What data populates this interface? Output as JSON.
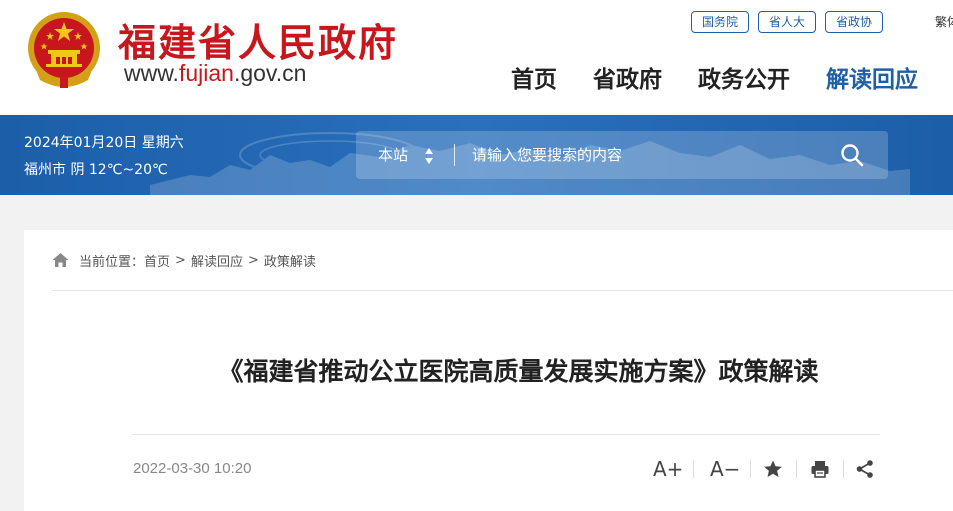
{
  "header": {
    "site_title": "福建省人民政府",
    "url_prefix": "www.",
    "url_highlight": "fujian",
    "url_suffix": ".gov.cn",
    "top_links": [
      "国务院",
      "省人大",
      "省政协"
    ],
    "lang_toggle": "繁体",
    "nav": [
      "首页",
      "省政府",
      "政务公开",
      "解读回应"
    ],
    "nav_active": "解读回应"
  },
  "banner": {
    "date": "2024年01月20日 星期六",
    "weather": "福州市 阴 12℃~20℃"
  },
  "search": {
    "scope": "本站",
    "placeholder": "请输入您要搜索的内容",
    "button_icon": "search-icon"
  },
  "breadcrumb": {
    "label": "当前位置：",
    "items": [
      "首页",
      "解读回应",
      "政策解读"
    ],
    "separator": ">"
  },
  "article": {
    "title": "《福建省推动公立医院高质量发展实施方案》政策解读",
    "date": "2022-03-30 10:20"
  },
  "tools": {
    "font_increase": "A+",
    "font_decrease": "A−",
    "icons": [
      "font-increase-icon",
      "font-decrease-icon",
      "favorite-star-icon",
      "print-icon",
      "share-icon"
    ]
  },
  "colors": {
    "brand_red": "#c8161d",
    "brand_blue": "#1f5fa8",
    "banner_blue": "#1c5ea8"
  }
}
